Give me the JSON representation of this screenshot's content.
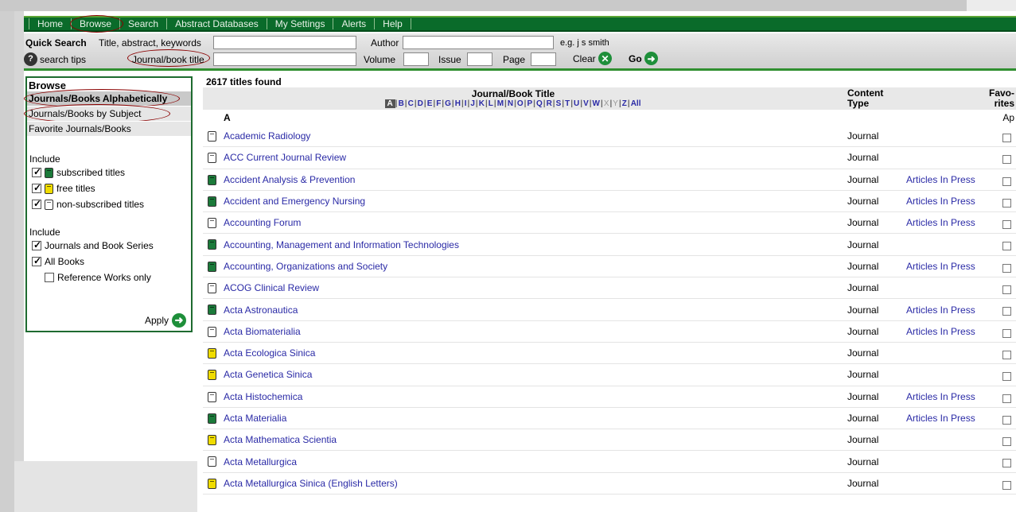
{
  "nav": {
    "items": [
      "Home",
      "Browse",
      "Search",
      "Abstract Databases",
      "My Settings",
      "Alerts",
      "Help"
    ],
    "active": "Browse"
  },
  "quick_search": {
    "title": "Quick Search",
    "tak_label": "Title, abstract, keywords",
    "author_label": "Author",
    "author_example": "e.g. j s smith",
    "tips_label": "search tips",
    "journal_label": "Journal/book title",
    "volume_label": "Volume",
    "issue_label": "Issue",
    "page_label": "Page",
    "clear_label": "Clear",
    "go_label": "Go"
  },
  "sidebar": {
    "heading": "Browse",
    "items": [
      "Journals/Books Alphabetically",
      "Journals/Books by Subject",
      "Favorite Journals/Books"
    ],
    "include1_label": "Include",
    "include1": [
      {
        "label": "subscribed titles",
        "checked": true,
        "icon": "subscribed-book-icon"
      },
      {
        "label": "free titles",
        "checked": true,
        "icon": "free-book-icon"
      },
      {
        "label": "non-subscribed titles",
        "checked": true,
        "icon": "non-subscribed-book-icon"
      }
    ],
    "include2_label": "Include",
    "include2": [
      {
        "label": "Journals and Book Series",
        "checked": true
      },
      {
        "label": "All Books",
        "checked": true
      },
      {
        "label": "Reference Works only",
        "checked": false
      }
    ],
    "apply_label": "Apply"
  },
  "results": {
    "count": "2617 titles found",
    "col_title": "Journal/Book Title",
    "col_type": "Content Type",
    "col_fav": "Favo- rites",
    "letters": [
      "A",
      "B",
      "C",
      "D",
      "E",
      "F",
      "G",
      "H",
      "I",
      "J",
      "K",
      "L",
      "M",
      "N",
      "O",
      "P",
      "Q",
      "R",
      "S",
      "T",
      "U",
      "V",
      "W",
      "X",
      "Y",
      "Z",
      "All"
    ],
    "current_letter": "A",
    "disabled_letters": [
      "X",
      "Y"
    ],
    "section_letter": "A",
    "fav_apply": "Ap",
    "rows": [
      {
        "title": "Academic Radiology",
        "type": "Journal",
        "status": "non",
        "aip": ""
      },
      {
        "title": "ACC Current Journal Review",
        "type": "Journal",
        "status": "non",
        "aip": ""
      },
      {
        "title": "Accident Analysis & Prevention",
        "type": "Journal",
        "status": "sub",
        "aip": "Articles In Press"
      },
      {
        "title": "Accident and Emergency Nursing",
        "type": "Journal",
        "status": "sub",
        "aip": "Articles In Press"
      },
      {
        "title": "Accounting Forum",
        "type": "Journal",
        "status": "non",
        "aip": "Articles In Press"
      },
      {
        "title": "Accounting, Management and Information Technologies",
        "type": "Journal",
        "status": "sub",
        "aip": ""
      },
      {
        "title": "Accounting, Organizations and Society",
        "type": "Journal",
        "status": "sub",
        "aip": "Articles In Press"
      },
      {
        "title": "ACOG Clinical Review",
        "type": "Journal",
        "status": "non",
        "aip": ""
      },
      {
        "title": "Acta Astronautica",
        "type": "Journal",
        "status": "sub",
        "aip": "Articles In Press"
      },
      {
        "title": "Acta Biomaterialia",
        "type": "Journal",
        "status": "non",
        "aip": "Articles In Press"
      },
      {
        "title": "Acta Ecologica Sinica",
        "type": "Journal",
        "status": "free",
        "aip": ""
      },
      {
        "title": "Acta Genetica Sinica",
        "type": "Journal",
        "status": "free",
        "aip": ""
      },
      {
        "title": "Acta Histochemica",
        "type": "Journal",
        "status": "non",
        "aip": "Articles In Press"
      },
      {
        "title": "Acta Materialia",
        "type": "Journal",
        "status": "sub",
        "aip": "Articles In Press"
      },
      {
        "title": "Acta Mathematica Scientia",
        "type": "Journal",
        "status": "free",
        "aip": ""
      },
      {
        "title": "Acta Metallurgica",
        "type": "Journal",
        "status": "non",
        "aip": ""
      },
      {
        "title": "Acta Metallurgica Sinica (English Letters)",
        "type": "Journal",
        "status": "free",
        "aip": ""
      }
    ]
  },
  "colors": {
    "nav_green": "#0a6b2a",
    "link_blue": "#2a2aa6",
    "subscribed": "#1b7a3a",
    "free": "#f0dc00",
    "annotation_oval": "#8b0000"
  }
}
